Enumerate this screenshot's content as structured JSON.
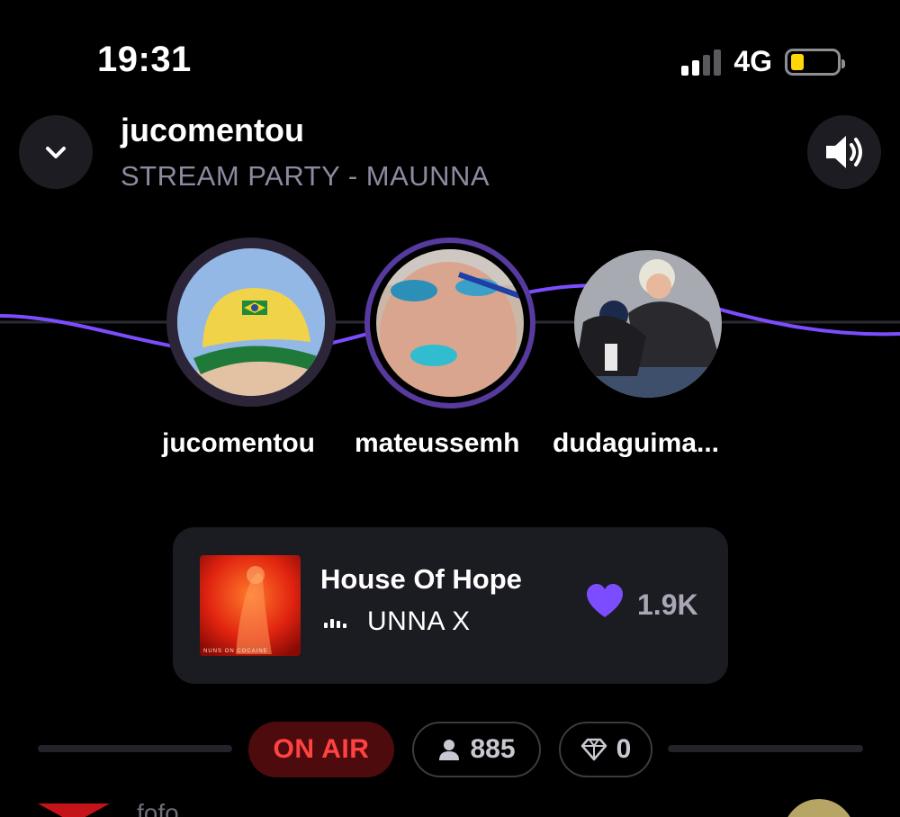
{
  "status_bar": {
    "time": "19:31",
    "network": "4G",
    "signal_bars_active": 2,
    "signal_bars_total": 4,
    "battery_level": 0.2,
    "battery_color": "#ffd60a"
  },
  "header": {
    "title": "jucomentou",
    "subtitle": "STREAM PARTY - MAUNNA",
    "collapse_icon": "chevron-down-icon",
    "volume_icon": "speaker-volume-icon"
  },
  "participants": [
    {
      "name": "jucomentou",
      "avatar": "avatar-yellow-cap"
    },
    {
      "name": "mateussemh",
      "avatar": "avatar-blue-makeup"
    },
    {
      "name": "dudaguima...",
      "avatar": "avatar-couple"
    }
  ],
  "now_playing": {
    "title": "House Of Hope",
    "artist": "UNNA X",
    "cover_caption": "NUNS ON COCAINE",
    "likes": "1.9K",
    "heart_icon": "heart-icon",
    "eq_icon": "equalizer-icon",
    "accent": "#7c4dff"
  },
  "stats": {
    "on_air_label": "ON AIR",
    "listeners": "885",
    "listeners_icon": "person-icon",
    "gems": "0",
    "gems_icon": "diamond-icon",
    "on_air_color": "#ff4242"
  },
  "chat_preview": {
    "name": "fofo"
  }
}
